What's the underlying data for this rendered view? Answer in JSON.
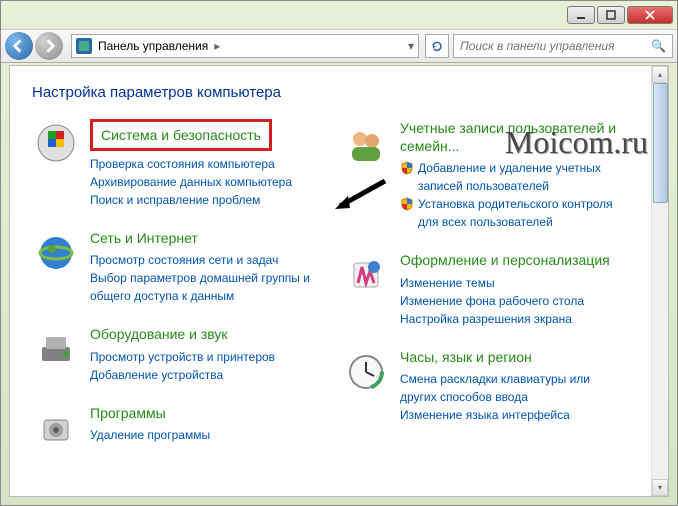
{
  "titlebar": {},
  "nav": {
    "breadcrumb": "Панель управления",
    "search_placeholder": "Поиск в панели управления"
  },
  "heading": "Настройка параметров компьютера",
  "watermark": "Moicom.ru",
  "left": [
    {
      "title": "Система и безопасность",
      "highlighted": true,
      "subs": [
        {
          "text": "Проверка состояния компьютера"
        },
        {
          "text": "Архивирование данных компьютера"
        },
        {
          "text": "Поиск и исправление проблем"
        }
      ]
    },
    {
      "title": "Сеть и Интернет",
      "subs": [
        {
          "text": "Просмотр состояния сети и задач"
        },
        {
          "text": "Выбор параметров домашней группы и общего доступа к данным"
        }
      ]
    },
    {
      "title": "Оборудование и звук",
      "subs": [
        {
          "text": "Просмотр устройств и принтеров"
        },
        {
          "text": "Добавление устройства"
        }
      ]
    },
    {
      "title": "Программы",
      "subs": [
        {
          "text": "Удаление программы"
        }
      ]
    }
  ],
  "right": [
    {
      "title": "Учетные записи пользователей и семейн...",
      "subs": [
        {
          "text": "Добавление и удаление учетных записей пользователей",
          "shield": true
        },
        {
          "text": "Установка родительского контроля для всех пользователей",
          "shield": true
        }
      ]
    },
    {
      "title": "Оформление и персонализация",
      "subs": [
        {
          "text": "Изменение темы"
        },
        {
          "text": "Изменение фона рабочего стола"
        },
        {
          "text": "Настройка разрешения экрана"
        }
      ]
    },
    {
      "title": "Часы, язык и регион",
      "subs": [
        {
          "text": "Смена раскладки клавиатуры или других способов ввода"
        },
        {
          "text": "Изменение языка интерфейса"
        }
      ]
    }
  ]
}
